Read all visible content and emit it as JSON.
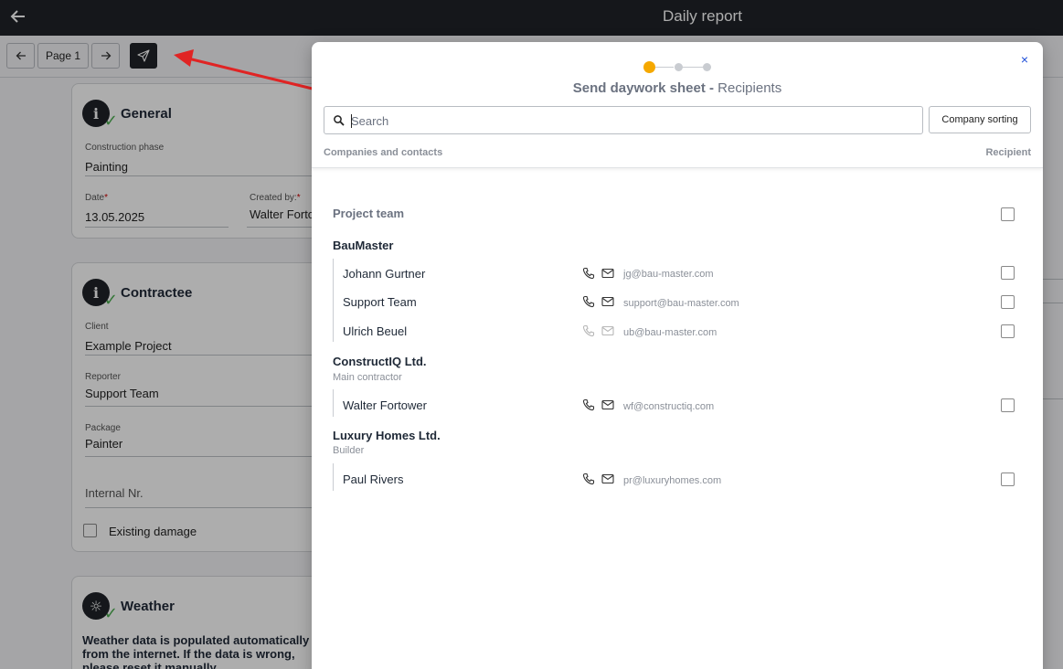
{
  "topbar": {
    "title": "Daily report"
  },
  "toolbar": {
    "page_label": "Page 1"
  },
  "general": {
    "title": "General",
    "phase_label": "Construction phase",
    "phase_value": "Painting",
    "date_label": "Date",
    "date_value": "13.05.2025",
    "created_label": "Created by:",
    "created_value": "Walter Fortower",
    "required_mark": "*"
  },
  "contractee": {
    "title": "Contractee",
    "client_label": "Client",
    "client_value": "Example Project",
    "reporter_label": "Reporter",
    "reporter_value": "Support Team",
    "package_label": "Package",
    "package_value": "Painter",
    "internal_placeholder": "Internal Nr.",
    "damage_label": "Existing damage"
  },
  "weather": {
    "title": "Weather",
    "text": "Weather data is populated automatically from the internet. If the data is wrong, please reset it manually."
  },
  "modal": {
    "title_bold": "Send daywork sheet -",
    "title_step": "Recipients",
    "close_label": "×",
    "search_placeholder": "Search",
    "sort_label": "Company sorting",
    "col_left": "Companies and contacts",
    "col_right": "Recipient",
    "project_team": "Project team",
    "companies": [
      {
        "name": "BauMaster",
        "role": "",
        "contacts": [
          {
            "name": "Johann Gurtner",
            "email": "jg@bau-master.com",
            "enabled": true
          },
          {
            "name": "Support Team",
            "email": "support@bau-master.com",
            "enabled": true
          },
          {
            "name": "Ulrich Beuel",
            "email": "ub@bau-master.com",
            "enabled": false
          }
        ]
      },
      {
        "name": "ConstructIQ Ltd.",
        "role": "Main contractor",
        "contacts": [
          {
            "name": "Walter Fortower",
            "email": "wf@constructiq.com",
            "enabled": true
          }
        ]
      },
      {
        "name": "Luxury Homes Ltd.",
        "role": "Builder",
        "contacts": [
          {
            "name": "Paul Rivers",
            "email": "pr@luxuryhomes.com",
            "enabled": true
          }
        ]
      }
    ]
  },
  "colors": {
    "accent": "#f5a800",
    "dark": "#1f2329",
    "annotation_arrow": "#e02424"
  }
}
